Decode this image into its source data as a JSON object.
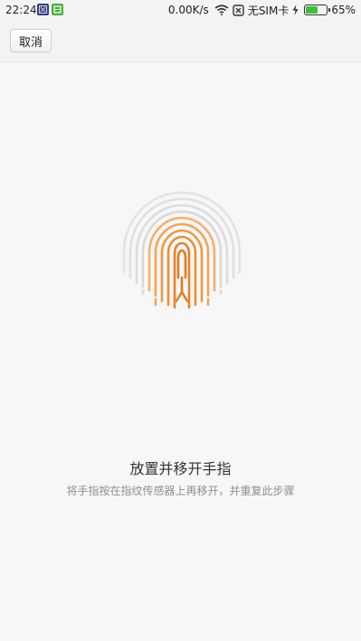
{
  "status_bar": {
    "time": "22:24",
    "network_speed": "0.00K/s",
    "sim_status": "无SIM卡",
    "battery_text": "65%",
    "battery_level": 0.65,
    "icons": [
      "notification-app-icon",
      "notification-app-icon",
      "wifi-icon",
      "no-sim-icon",
      "charging-icon",
      "battery-icon"
    ]
  },
  "header": {
    "cancel_label": "取消"
  },
  "main": {
    "fingerprint_icon": "fingerprint-icon",
    "title": "放置并移开手指",
    "hint": "将手指按在指纹传感器上再移开，并重复此步骤"
  },
  "colors": {
    "accent": "#ef8a1e",
    "fingerprint_gray": "#e3e3e3",
    "background": "#f7f7f7"
  }
}
